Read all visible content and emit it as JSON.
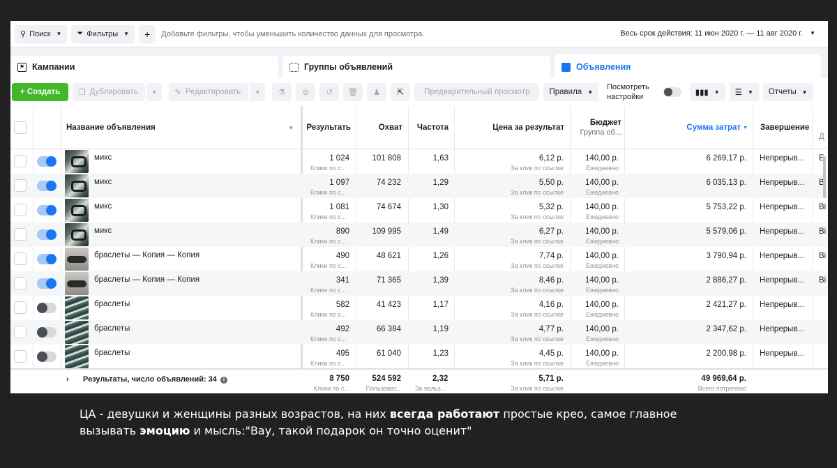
{
  "filterbar": {
    "search_label": "Поиск",
    "filters_label": "Фильтры",
    "add_label": "+",
    "hint": "Добавьте фильтры, чтобы уменьшить количество данных для просмотра.",
    "date_range": "Весь срок действия: 11 июн 2020 г. — 11 авг 2020 г."
  },
  "tabs": [
    {
      "label": "Кампании",
      "icon": "campaign-icon"
    },
    {
      "label": "Группы объявлений",
      "icon": "grid-icon"
    },
    {
      "label": "Объявления",
      "icon": "ad-icon",
      "active": true
    }
  ],
  "toolbar": {
    "create": "+ Создать",
    "duplicate": "Дублировать",
    "edit": "Редактировать",
    "preview": "Предварительный просмотр",
    "rules": "Правила",
    "see_settings_1": "Посмотреть",
    "see_settings_2": "настройки",
    "reports": "Отчеты"
  },
  "columns": {
    "name": "Название объявления",
    "results": "Результать",
    "reach": "Охват",
    "frequency": "Частота",
    "cost_per_result": "Цена за результат",
    "budget": "Бюджет",
    "budget_sub": "Группа об...",
    "amount_spent": "Сумма затрат",
    "ends": "Завершение",
    "extra": "Д"
  },
  "rows": [
    {
      "on": true,
      "thumb": "mix",
      "name": "микс",
      "results": "1 024",
      "results_sub": "Клики по с...",
      "reach": "101 808",
      "freq": "1,63",
      "cpr": "6,12 р.",
      "cpr_sub": "За клик по ссылке",
      "budget": "140,00 р.",
      "budget_sub": "Ежедневно",
      "spent": "6 269,17 р.",
      "ends": "Непрерыв...",
      "extra": "Е"
    },
    {
      "on": true,
      "thumb": "mix",
      "name": "микс",
      "results": "1 097",
      "results_sub": "Клики по с...",
      "reach": "74 232",
      "freq": "1,29",
      "cpr": "5,50 р.",
      "cpr_sub": "За клик по ссылке",
      "budget": "140,00 р.",
      "budget_sub": "Ежедневно",
      "spent": "6 035,13 р.",
      "ends": "Непрерыв...",
      "extra": "В"
    },
    {
      "on": true,
      "thumb": "mix",
      "name": "микс",
      "results": "1 081",
      "results_sub": "Клики по с...",
      "reach": "74 674",
      "freq": "1,30",
      "cpr": "5,32 р.",
      "cpr_sub": "За клик по ссылке",
      "budget": "140,00 р.",
      "budget_sub": "Ежедневно",
      "spent": "5 753,22 р.",
      "ends": "Непрерыв...",
      "extra": "Ві"
    },
    {
      "on": true,
      "thumb": "mix",
      "name": "микс",
      "results": "890",
      "results_sub": "Клики по с...",
      "reach": "109 995",
      "freq": "1,49",
      "cpr": "6,27 р.",
      "cpr_sub": "За клик по ссылке",
      "budget": "140,00 р.",
      "budget_sub": "Ежедневно",
      "spent": "5 579,06 р.",
      "ends": "Непрерыв...",
      "extra": "Ві"
    },
    {
      "on": true,
      "thumb": "copy",
      "name": "браслеты — Копия — Копия",
      "results": "490",
      "results_sub": "Клики по с...",
      "reach": "48 621",
      "freq": "1,26",
      "cpr": "7,74 р.",
      "cpr_sub": "За клик по ссылке",
      "budget": "140,00 р.",
      "budget_sub": "Ежедневно",
      "spent": "3 790,94 р.",
      "ends": "Непрерыв...",
      "extra": "Ві"
    },
    {
      "on": true,
      "thumb": "copy",
      "name": "браслеты — Копия — Копия",
      "results": "341",
      "results_sub": "Клики по с...",
      "reach": "71 365",
      "freq": "1,39",
      "cpr": "8,46 р.",
      "cpr_sub": "За клик по ссылке",
      "budget": "140,00 р.",
      "budget_sub": "Ежедневно",
      "spent": "2 886,27 р.",
      "ends": "Непрерыв...",
      "extra": "Ві"
    },
    {
      "on": false,
      "thumb": "br",
      "name": "браслеты",
      "results": "582",
      "results_sub": "Клики по с...",
      "reach": "41 423",
      "freq": "1,17",
      "cpr": "4,16 р.",
      "cpr_sub": "За клик по ссылке",
      "budget": "140,00 р.",
      "budget_sub": "Ежедневно",
      "spent": "2 421,27 р.",
      "ends": "Непрерыв...",
      "extra": ""
    },
    {
      "on": false,
      "thumb": "br",
      "name": "браслеты",
      "results": "492",
      "results_sub": "Клики по с...",
      "reach": "66 384",
      "freq": "1,19",
      "cpr": "4,77 р.",
      "cpr_sub": "За клик по ссылке",
      "budget": "140,00 р.",
      "budget_sub": "Ежедневно",
      "spent": "2 347,62 р.",
      "ends": "Непрерыв...",
      "extra": ""
    },
    {
      "on": false,
      "thumb": "br",
      "name": "браслеты",
      "results": "495",
      "results_sub": "Клики по с...",
      "reach": "61 040",
      "freq": "1,23",
      "cpr": "4,45 р.",
      "cpr_sub": "За клик по ссылке",
      "budget": "140,00 р.",
      "budget_sub": "Ежедневно",
      "spent": "2 200,98 р.",
      "ends": "Непрерыв...",
      "extra": ""
    }
  ],
  "totals": {
    "label": "Результаты, число объявлений: 34",
    "results": "8 750",
    "results_sub": "Клики по с...",
    "reach": "524 592",
    "reach_sub": "Пользоват...",
    "freq": "2,32",
    "freq_sub": "За польз...",
    "cpr": "5,71 р.",
    "cpr_sub": "За клик по ссылке",
    "spent": "49 969,64 р.",
    "spent_sub": "Всего потрачено"
  },
  "caption": {
    "p1": "ЦА - девушки и женщины разных возрастов, на них ",
    "b1": "всегда работают",
    "p2": " простые крео, самое главное",
    "p3": "вызывать ",
    "b2": "эмоцию",
    "p4": " и мысль:\"Вау, такой подарок он точно оценит\""
  },
  "colors": {
    "accent": "#1877f2",
    "create": "#42b72a",
    "background": "#212121"
  }
}
